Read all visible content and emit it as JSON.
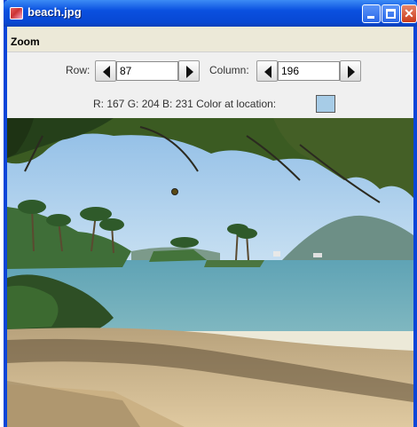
{
  "window": {
    "title": "beach.jpg"
  },
  "menu": {
    "items": [
      {
        "label": "Zoom"
      }
    ]
  },
  "controls": {
    "row_label": "Row:",
    "row_value": "87",
    "column_label": "Column:",
    "column_value": "196",
    "color_info": "R: 167 G: 204 B: 231 Color at location:",
    "swatch_color": "#a7cce7"
  },
  "colors": {
    "title_bar": "#0a50e0",
    "window_border": "#0a45d8"
  },
  "image": {
    "alt": "beach photo"
  }
}
